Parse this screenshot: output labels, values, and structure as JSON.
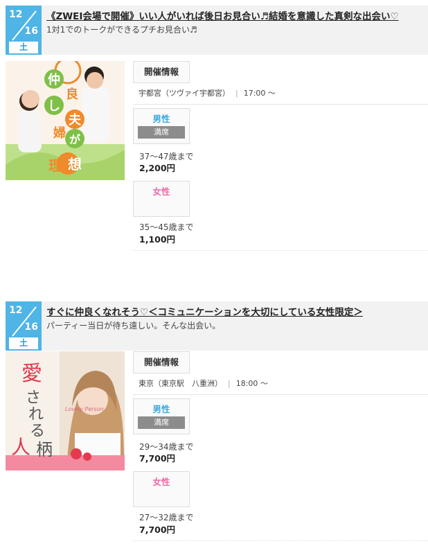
{
  "events": [
    {
      "month": "12",
      "day": "16",
      "weekday": "土",
      "title": "《ZWEI会場で開催》いい人がいれば後日お見合い♬結婚を意識した真剣な出会い♡",
      "subtitle": "1対1でのトークができるプチお見合い♬",
      "image_text": [
        "仲",
        "良",
        "し",
        "夫",
        "婦",
        "が",
        "理",
        "想"
      ],
      "info_tag": "開催情報",
      "venue": "宇都宮（ツヴァイ宇都宮）",
      "time": "17:00 ～",
      "male": {
        "label": "男性",
        "status": "満席",
        "age": "37～47歳まで",
        "price": "2,200円"
      },
      "female": {
        "label": "女性",
        "age": "35～45歳まで",
        "price": "1,100円"
      }
    },
    {
      "month": "12",
      "day": "16",
      "weekday": "土",
      "title": "すぐに仲良くなれそう♡＜コミュニケーションを大切にしている女性限定＞",
      "subtitle": "パーティー当日が待ち遠しい。そんな出会い。",
      "image_text": [
        "愛",
        "さ",
        "れ",
        "る",
        "人",
        "柄"
      ],
      "image_script": "Lovely Person",
      "info_tag": "開催情報",
      "venue": "東京（東京駅　八重洲）",
      "time": "18:00 ～",
      "male": {
        "label": "男性",
        "status": "満席",
        "age": "29～34歳まで",
        "price": "7,700円"
      },
      "female": {
        "label": "女性",
        "age": "27～32歳まで",
        "price": "7,700円"
      }
    }
  ],
  "colors": {
    "date_blue": "#4fb4e6",
    "male": "#3aa8e0",
    "female": "#ee6aa7",
    "full_badge": "#8c8c8c"
  }
}
